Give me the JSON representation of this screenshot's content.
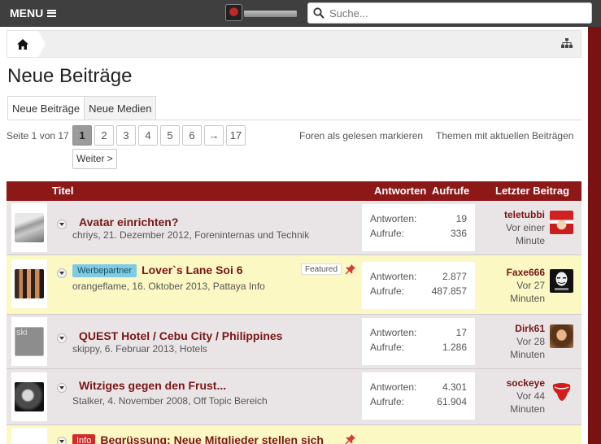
{
  "header": {
    "menu_label": "MENU",
    "search_placeholder": "Suche..."
  },
  "page": {
    "title": "Neue Beiträge",
    "tabs": [
      {
        "label": "Neue Beiträge",
        "active": true
      },
      {
        "label": "Neue Medien",
        "active": false
      }
    ]
  },
  "pagination": {
    "label": "Seite 1 von 17",
    "pages": [
      "1",
      "2",
      "3",
      "4",
      "5",
      "6",
      "→",
      "17"
    ],
    "current": "1",
    "next_label": "Weiter >"
  },
  "actions": {
    "mark_read": "Foren als gelesen markieren",
    "active_threads": "Themen mit aktuellen Beiträgen"
  },
  "table": {
    "col_title": "Titel",
    "col_replies": "Antworten",
    "col_views": "Aufrufe",
    "col_last": "Letzter Beitrag"
  },
  "threads": [
    {
      "title": "Avatar einrichten?",
      "author": "chriys",
      "date": "21. Dezember 2012",
      "forum": "Foreninternas und Technik",
      "replies_label": "Antworten:",
      "replies": "19",
      "views_label": "Aufrufe:",
      "views": "336",
      "last_user": "teletubbi",
      "last_time": "Vor einer Minute",
      "avatar_icon": "thread-avatar-chriys",
      "last_avatar_icon": "santa-avatar"
    },
    {
      "prefix": "Werbepartner",
      "title": "Lover`s Lane Soi 6",
      "featured": "Featured",
      "author": "orangeflame",
      "date": "16. Oktober 2013",
      "forum": "Pattaya Info",
      "replies_label": "Antworten:",
      "replies": "2.877",
      "views_label": "Aufrufe:",
      "views": "487.857",
      "last_user": "Faxe666",
      "last_time": "Vor 27 Minuten",
      "avatar_icon": "thread-avatar-orangeflame",
      "last_avatar_icon": "anonymous-mask-avatar"
    },
    {
      "title": "QUEST Hotel / Cebu City / Philippines",
      "author": "skippy",
      "date": "6. Februar 2013",
      "forum": "Hotels",
      "replies_label": "Antworten:",
      "replies": "17",
      "views_label": "Aufrufe:",
      "views": "1.286",
      "last_user": "Dirk61",
      "last_time": "Vor 28 Minuten",
      "avatar_alt": "ski",
      "last_avatar_icon": "woman-avatar"
    },
    {
      "title": "Witziges gegen den Frust...",
      "author": "Stalker",
      "date": "4. November 2008",
      "forum": "Off Topic Bereich",
      "replies_label": "Antworten:",
      "replies": "4.301",
      "views_label": "Aufrufe:",
      "views": "61.904",
      "last_user": "sockeye",
      "last_time": "Vor 44 Minuten",
      "avatar_icon": "thread-avatar-stalker",
      "last_avatar_icon": "rolling-stones-tongue-avatar"
    },
    {
      "prefix": "Info",
      "title": "Begrüssung: Neue Mitglieder stellen sich"
    }
  ],
  "colors": {
    "brand_red": "#8c1818",
    "title_red": "#7a1515",
    "sticky_bg": "#fbf8c4",
    "row_bg": "#e9e5e6",
    "topbar": "#3f3f3f"
  }
}
